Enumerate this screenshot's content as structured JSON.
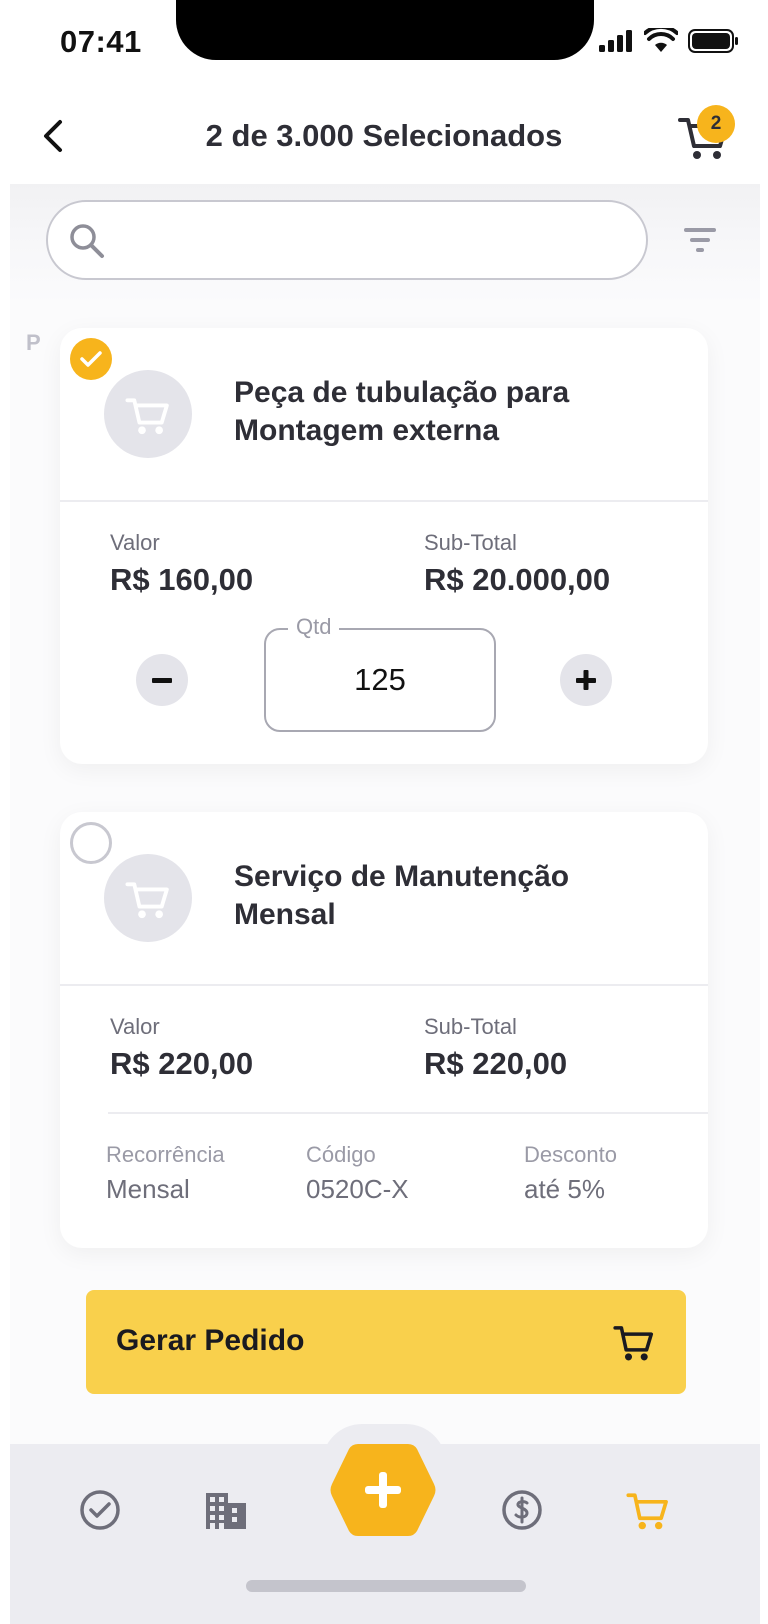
{
  "status_bar": {
    "time": "07:41"
  },
  "header": {
    "title": "2 de 3.000 Selecionados",
    "cart_count": "2"
  },
  "side_letter": "P",
  "search": {
    "placeholder": "",
    "value": ""
  },
  "products": [
    {
      "name": "Peça de tubulação para Montagem externa",
      "selected": true,
      "value_label": "Valor",
      "value": "R$ 160,00",
      "subtotal_label": "Sub-Total",
      "subtotal": "R$ 20.000,00",
      "qty_label": "Qtd",
      "qty": "125"
    },
    {
      "name": "Serviço de Manutenção Mensal",
      "selected": false,
      "value_label": "Valor",
      "value": "R$ 220,00",
      "subtotal_label": "Sub-Total",
      "subtotal": "R$ 220,00",
      "recurrence_label": "Recorrência",
      "recurrence": "Mensal",
      "code_label": "Código",
      "code": "0520C-X",
      "discount_label": "Desconto",
      "discount": "até 5%"
    }
  ],
  "primary_action": {
    "label": "Gerar Pedido",
    "icon": "cart-icon"
  },
  "tab_bar": {
    "items": [
      "check-circle-icon",
      "building-icon",
      "plus-icon",
      "dollar-icon",
      "cart-icon"
    ],
    "active": "cart-icon"
  },
  "colors": {
    "accent": "#f7b41c",
    "button": "#f9d04c",
    "text": "#2e2e36",
    "tab_bar": "#ececf1"
  }
}
